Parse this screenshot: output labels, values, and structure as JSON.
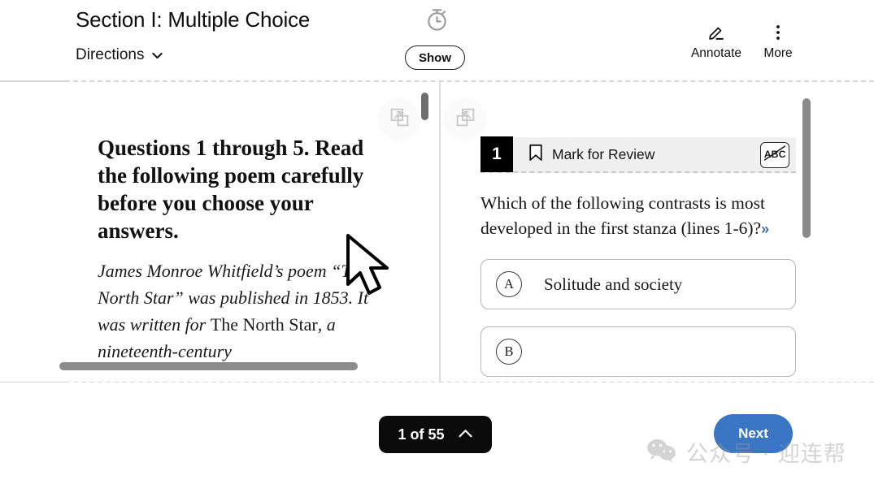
{
  "header": {
    "section_title": "Section I: Multiple Choice",
    "directions_label": "Directions",
    "chevron_icon": "chevron-down-icon",
    "timer_icon": "stopwatch-icon",
    "show_button": "Show",
    "tools": [
      {
        "label": "Annotate",
        "icon": "pencil-underline-icon"
      },
      {
        "label": "More",
        "icon": "more-vertical-icon"
      }
    ]
  },
  "passage": {
    "heading": "Questions 1 through 5. Read the following poem carefully before you choose your answers.",
    "body_segments": [
      {
        "text": "James Monroe Whitfield’s poem “The North Star” was published in 1853. It was written for ",
        "style": "italic"
      },
      {
        "text": "The North Star",
        "style": "roman"
      },
      {
        "text": ", a nineteenth-century",
        "style": "italic"
      }
    ]
  },
  "panel_controls": {
    "expand_left_icon": "expand-panel-right-icon",
    "expand_right_icon": "expand-panel-left-icon",
    "divider_handle": "panel-divider-handle"
  },
  "question": {
    "number": "1",
    "bookmark_icon": "bookmark-icon",
    "mark_for_review": "Mark for Review",
    "crossout_icon": "abc-strikethrough-icon",
    "crossout_label": "ABC",
    "prompt": "Which of the following contrasts is most developed in the first stanza (lines 1-6)?",
    "expand_arrows": "»",
    "choices": [
      {
        "letter": "A",
        "text": "Solitude and society"
      },
      {
        "letter": "B",
        "text": ""
      }
    ]
  },
  "footer": {
    "pager_label": "1 of 55",
    "pager_chevron_icon": "chevron-up-icon",
    "next_label": "Next"
  },
  "watermark": {
    "icon": "wechat-icon",
    "text": "公众号 · 迎连帮"
  },
  "colors": {
    "next_button": "#3b76c4",
    "pager_button": "#0b0b0b",
    "question_badge": "#000000",
    "question_header_bg": "#f0f0f0",
    "expand_arrows": "#3b6fb5"
  }
}
